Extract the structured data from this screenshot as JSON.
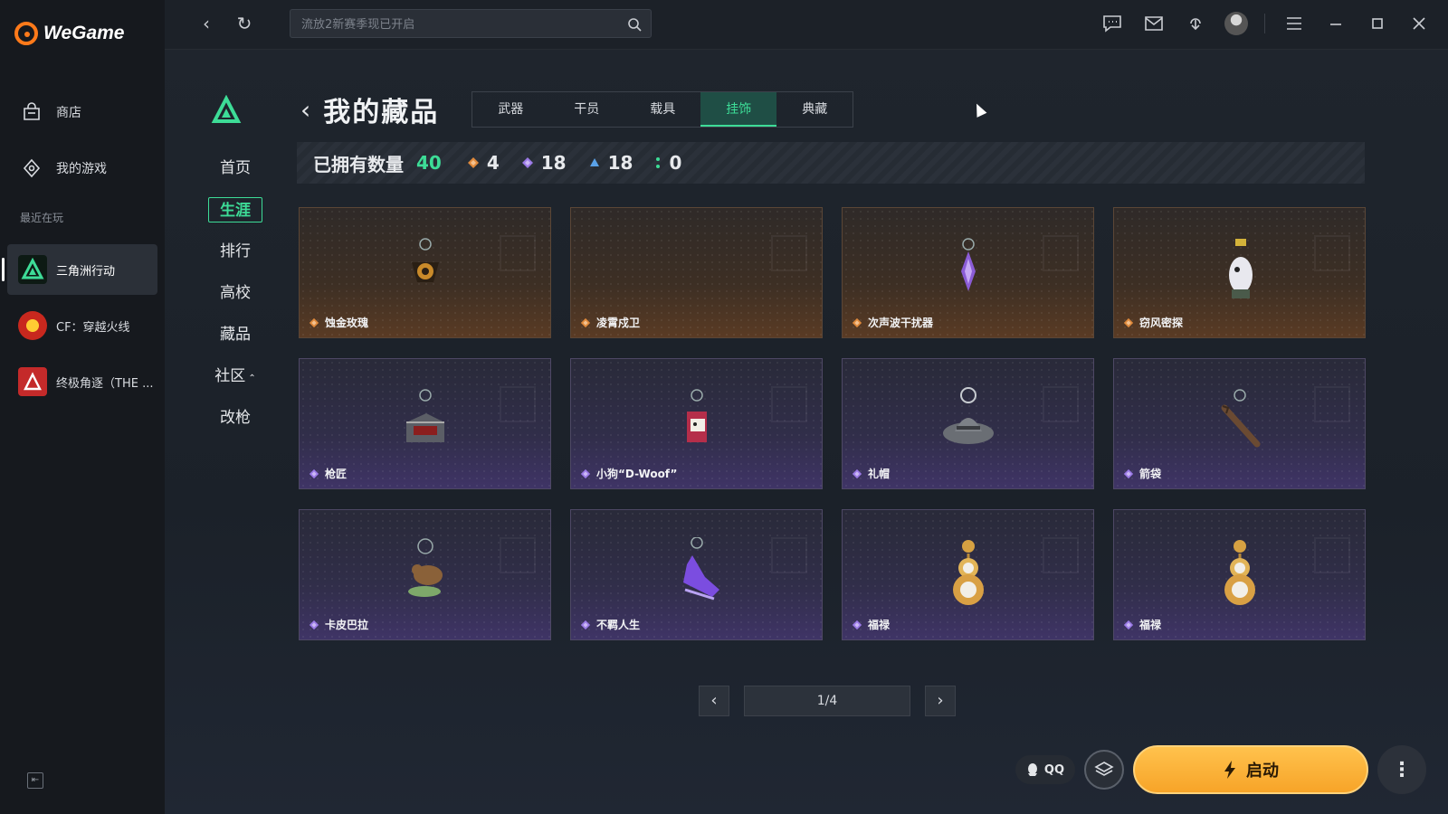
{
  "app": {
    "name": "WeGame",
    "brand_color": "#ff7a1a",
    "accent_color": "#3ddc97"
  },
  "sidebar": {
    "nav": [
      {
        "label": "商店",
        "icon": "store-bag-icon"
      },
      {
        "label": "我的游戏",
        "icon": "gamepad-icon"
      }
    ],
    "recent_label": "最近在玩",
    "recent_games": [
      {
        "label": "三角洲行动",
        "active": true
      },
      {
        "label": "CF：穿越火线",
        "active": false
      },
      {
        "label": "终极角逐（THE ...",
        "active": false
      }
    ]
  },
  "topbar": {
    "search_placeholder": "流放2新赛季现已开启"
  },
  "subnav": {
    "items": [
      "首页",
      "生涯",
      "排行",
      "高校",
      "藏品",
      "社区",
      "改枪"
    ],
    "active": "生涯"
  },
  "page": {
    "title": "我的藏品",
    "tabs": [
      "武器",
      "干员",
      "载具",
      "挂饰",
      "典藏"
    ],
    "active_tab": "挂饰"
  },
  "stats": {
    "label": "已拥有数量",
    "total": "40",
    "counts": [
      {
        "value": "4",
        "color": "#e08a3c"
      },
      {
        "value": "18",
        "color": "#9b7ae6"
      },
      {
        "value": "18",
        "color": "#5aa2e8"
      },
      {
        "value": "0",
        "color": "#3ddc97"
      }
    ]
  },
  "items": [
    {
      "name": "蚀金玫瑰",
      "rarity": "gold"
    },
    {
      "name": "凌霄戍卫",
      "rarity": "gold"
    },
    {
      "name": "次声波干扰器",
      "rarity": "gold"
    },
    {
      "name": "窃风密探",
      "rarity": "gold"
    },
    {
      "name": "枪匠",
      "rarity": "purple"
    },
    {
      "name": "小狗“D-Woof”",
      "rarity": "purple"
    },
    {
      "name": "礼帽",
      "rarity": "purple"
    },
    {
      "name": "箭袋",
      "rarity": "purple"
    },
    {
      "name": "卡皮巴拉",
      "rarity": "purple"
    },
    {
      "name": "不羁人生",
      "rarity": "purple"
    },
    {
      "name": "福禄",
      "rarity": "purple"
    },
    {
      "name": "福禄",
      "rarity": "purple"
    }
  ],
  "pagination": {
    "label": "1/4"
  },
  "bottom": {
    "qq_label": "QQ",
    "launch_label": "启动"
  }
}
